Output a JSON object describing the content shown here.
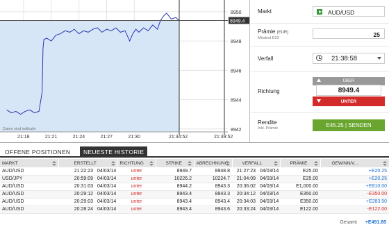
{
  "chart": {
    "current_price": "8949.4",
    "y_ticks": [
      "8950",
      "8948",
      "8946",
      "8944",
      "8942"
    ],
    "x_ticks": [
      "21:18",
      "21:21",
      "21:24",
      "21:27",
      "21:30"
    ],
    "marker_now": "21:34:52",
    "marker_end": "21:39:52",
    "disclaimer": "Daten sind indikativ"
  },
  "chart_data": {
    "type": "line",
    "x": [
      "21:16:10",
      "21:16:40",
      "21:17:10",
      "21:17:40",
      "21:18:10",
      "21:18:40",
      "21:19:10",
      "21:19:40",
      "21:20:00",
      "21:20:06",
      "21:20:12",
      "21:20:30",
      "21:21:00",
      "21:21:30",
      "21:22:00",
      "21:22:30",
      "21:23:00",
      "21:23:30",
      "21:24:00",
      "21:24:30",
      "21:25:00",
      "21:25:30",
      "21:26:00",
      "21:26:30",
      "21:27:00",
      "21:27:30",
      "21:28:00",
      "21:28:30",
      "21:29:00",
      "21:29:30",
      "21:29:50",
      "21:30:10",
      "21:30:30",
      "21:31:00",
      "21:31:30",
      "21:32:00",
      "21:32:30",
      "21:32:50",
      "21:33:10",
      "21:33:30",
      "21:34:00",
      "21:34:30",
      "21:34:52"
    ],
    "y": [
      8943.3,
      8943.1,
      8943.2,
      8943.0,
      8943.2,
      8943.3,
      8943.1,
      8943.2,
      8944.5,
      8947.5,
      8948.1,
      8948.2,
      8948.0,
      8948.4,
      8948.5,
      8948.7,
      8948.6,
      8948.8,
      8948.5,
      8948.7,
      8948.6,
      8948.8,
      8948.9,
      8948.6,
      8948.8,
      8948.7,
      8948.9,
      8948.6,
      8948.7,
      8948.0,
      8948.5,
      8948.8,
      8948.6,
      8948.9,
      8948.7,
      8949.1,
      8948.8,
      8949.4,
      8949.7,
      8949.9,
      8949.5,
      8949.6,
      8949.4
    ],
    "ylim": [
      8941.8,
      8950.8
    ],
    "current_value": 8949.4,
    "grid": true
  },
  "panel": {
    "market_label": "Markt",
    "market_value": "AUD/USD",
    "premium_label": "Prämie",
    "premium_unit": "(EUR)",
    "premium_min": "Mindest E23",
    "premium_value": "25",
    "expiry_label": "Verfall",
    "expiry_value": "21:38:58",
    "direction_label": "Richtung",
    "up_label": "ÜBER",
    "direction_price": "8949.4",
    "down_label": "UNTER",
    "return_label": "Rendite",
    "return_sub": "Inkl. Prämie",
    "send_label": "E45.25 | SENDEN"
  },
  "tabs": {
    "open": "OFFENE POSITIONEN",
    "history": "NEUESTE HISTORIE"
  },
  "table": {
    "headers": [
      "MARKT",
      "ERSTELLT",
      "RICHTUNG",
      "STRIKE",
      "ABRECHNUNG",
      "VERFALL",
      "PRÄMIE",
      "GEWINN/V..."
    ],
    "rows": [
      [
        "AUD/USD",
        "21:22:23",
        "04/03/14",
        "unter",
        "8949.7",
        "8948.8",
        "21:27:23",
        "04/03/14",
        "E25.00",
        "+E20.25"
      ],
      [
        "USD/JPY",
        "20:59:09",
        "04/03/14",
        "unter",
        "10226.2",
        "10224.7",
        "21:04:09",
        "04/03/14",
        "E25.00",
        "+E20.25"
      ],
      [
        "AUD/USD",
        "20:31:03",
        "04/03/14",
        "unter",
        "8944.2",
        "8943.3",
        "20:36:02",
        "04/03/14",
        "E1,000.00",
        "+E810.00"
      ],
      [
        "AUD/USD",
        "20:29:12",
        "04/03/14",
        "unter",
        "8943.4",
        "8943.3",
        "20:34:12",
        "04/03/14",
        "E350.00",
        "-E350.00"
      ],
      [
        "AUD/USD",
        "20:29:03",
        "04/03/14",
        "unter",
        "8943.4",
        "8943.4",
        "20:34:03",
        "04/03/14",
        "E350.00",
        "+E283.50"
      ],
      [
        "AUD/USD",
        "20:28:24",
        "04/03/14",
        "unter",
        "8943.4",
        "8943.6",
        "20:33:24",
        "04/03/14",
        "E122.00",
        "-E122.00"
      ]
    ],
    "total_label": "Gesamt",
    "total_value": "+E491.85"
  },
  "colors": {
    "chart_fill": "#d6e6f7",
    "chart_line": "#2a35b0",
    "down_red": "#d32a2a",
    "send_green": "#6aa62f",
    "profit_blue": "#1a6fd0"
  }
}
